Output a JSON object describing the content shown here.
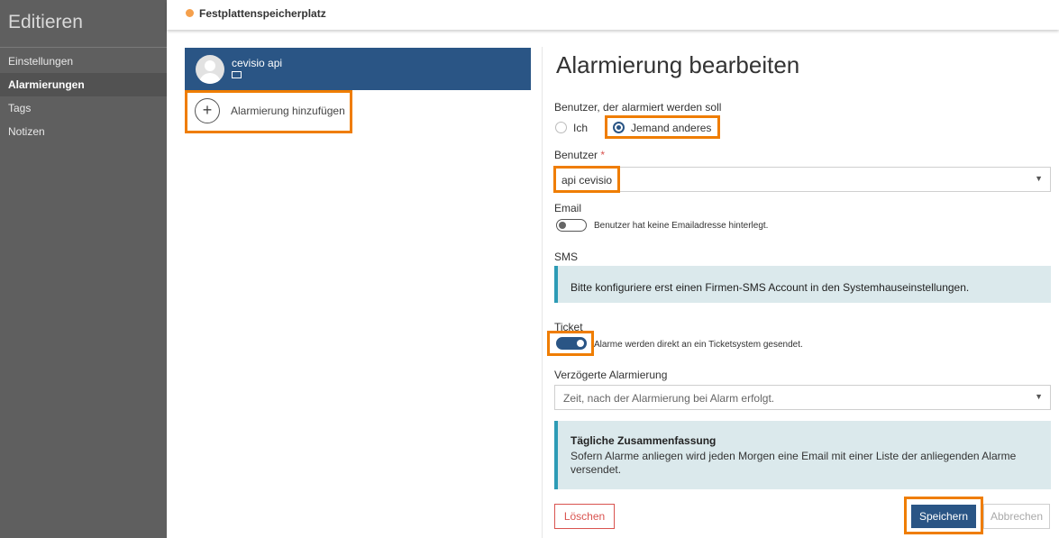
{
  "sidebar": {
    "title": "Editieren",
    "items": [
      {
        "label": "Einstellungen"
      },
      {
        "label": "Alarmierungen"
      },
      {
        "label": "Tags"
      },
      {
        "label": "Notizen"
      }
    ]
  },
  "header": {
    "breadcrumb": "Festplattenspeicherplatz",
    "status_color": "#f5a04c"
  },
  "list": {
    "selected_item": {
      "name": "cevisio api",
      "icon": "mail-icon"
    },
    "add_label": "Alarmierung hinzufügen"
  },
  "form": {
    "title": "Alarmierung bearbeiten",
    "recipient_label": "Benutzer, der alarmiert werden soll",
    "recipient_options": [
      "Ich",
      "Jemand anderes"
    ],
    "recipient_selected": "Jemand anderes",
    "user_label": "Benutzer",
    "required_mark": "*",
    "user_value": "api cevisio",
    "email_label": "Email",
    "email_enabled": false,
    "email_note": "Benutzer hat keine Emailadresse hinterlegt.",
    "sms_label": "SMS",
    "sms_info": "Bitte konfiguriere erst einen Firmen-SMS Account in den Systemhauseinstellungen.",
    "ticket_label": "Ticket",
    "ticket_enabled": true,
    "ticket_note": "Alarme werden direkt an ein Ticketsystem gesendet.",
    "delay_label": "Verzögerte Alarmierung",
    "delay_placeholder": "Zeit, nach der Alarmierung bei Alarm erfolgt.",
    "summary_title": "Tägliche Zusammenfassung",
    "summary_text": "Sofern Alarme anliegen wird jeden Morgen eine Email mit einer Liste der anliegenden Alarme versendet.",
    "delete_label": "Löschen",
    "save_label": "Speichern",
    "cancel_label": "Abbrechen"
  },
  "colors": {
    "primary": "#2a5585",
    "highlight": "#ef7d00",
    "danger": "#d9534f",
    "info_bg": "#dbe9ec"
  }
}
